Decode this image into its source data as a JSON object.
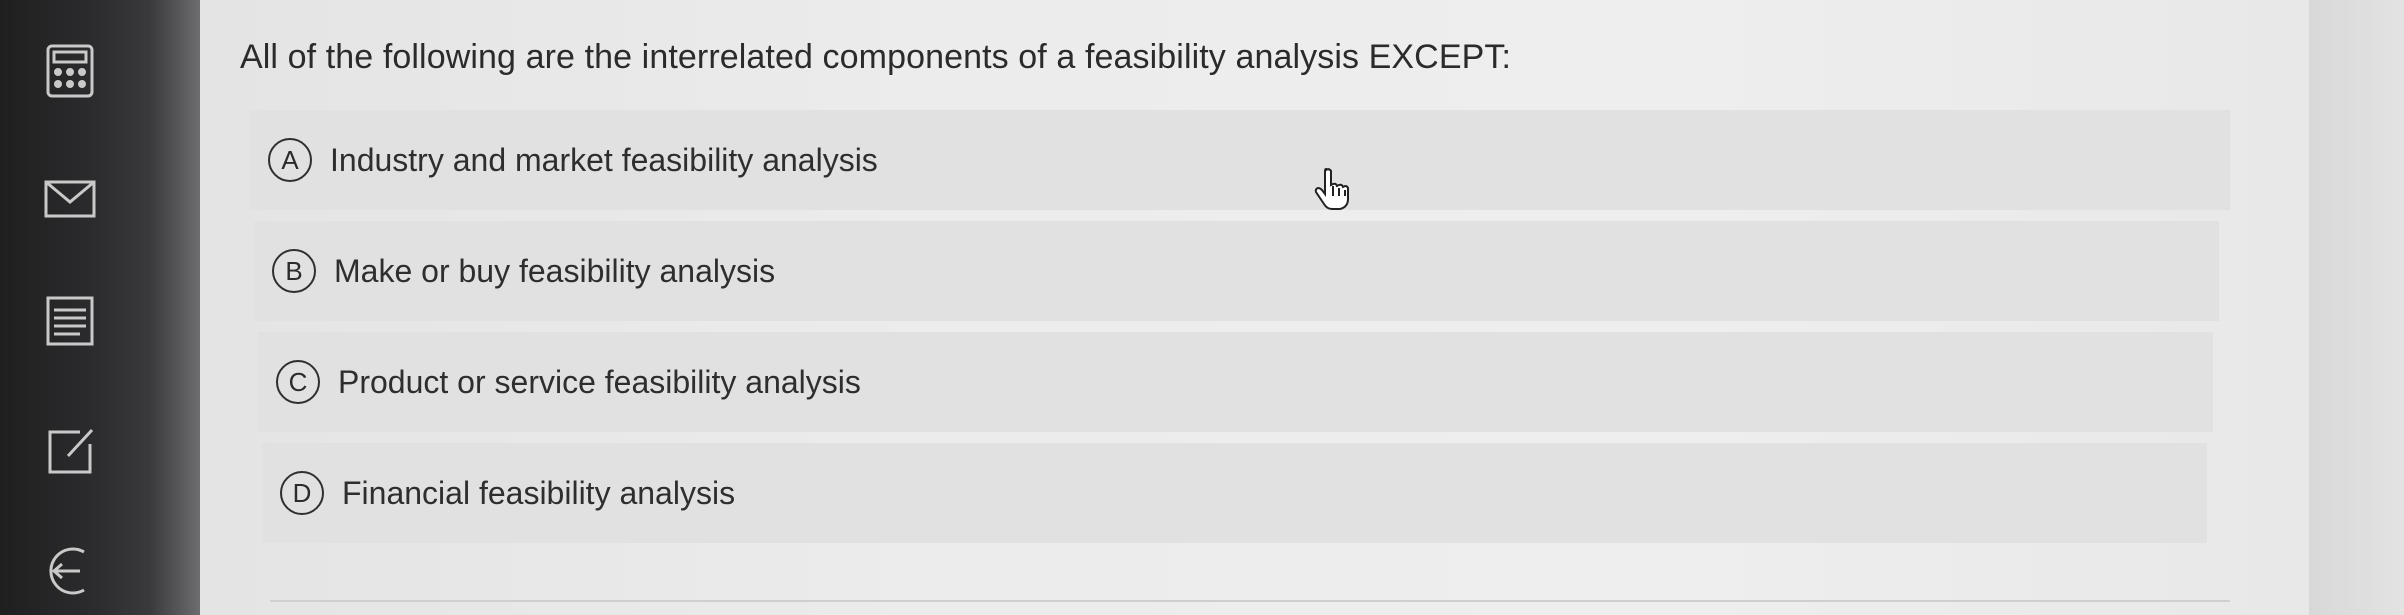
{
  "question": {
    "text": "All of the following are the interrelated components of a feasibility analysis EXCEPT:"
  },
  "options": [
    {
      "letter": "A",
      "text": "Industry and market feasibility analysis"
    },
    {
      "letter": "B",
      "text": "Make or buy feasibility analysis"
    },
    {
      "letter": "C",
      "text": "Product or service feasibility analysis"
    },
    {
      "letter": "D",
      "text": "Financial feasibility analysis"
    }
  ],
  "sidebar": {
    "icons": [
      "calculator-icon",
      "mail-icon",
      "notes-icon",
      "edit-icon",
      "back-icon"
    ]
  },
  "cursor": {
    "icon": "hand-pointer-icon"
  },
  "colors": {
    "sidebar": "#2b2b2d",
    "option_bg": "#e1e1e1",
    "text": "#2b2b2b"
  }
}
